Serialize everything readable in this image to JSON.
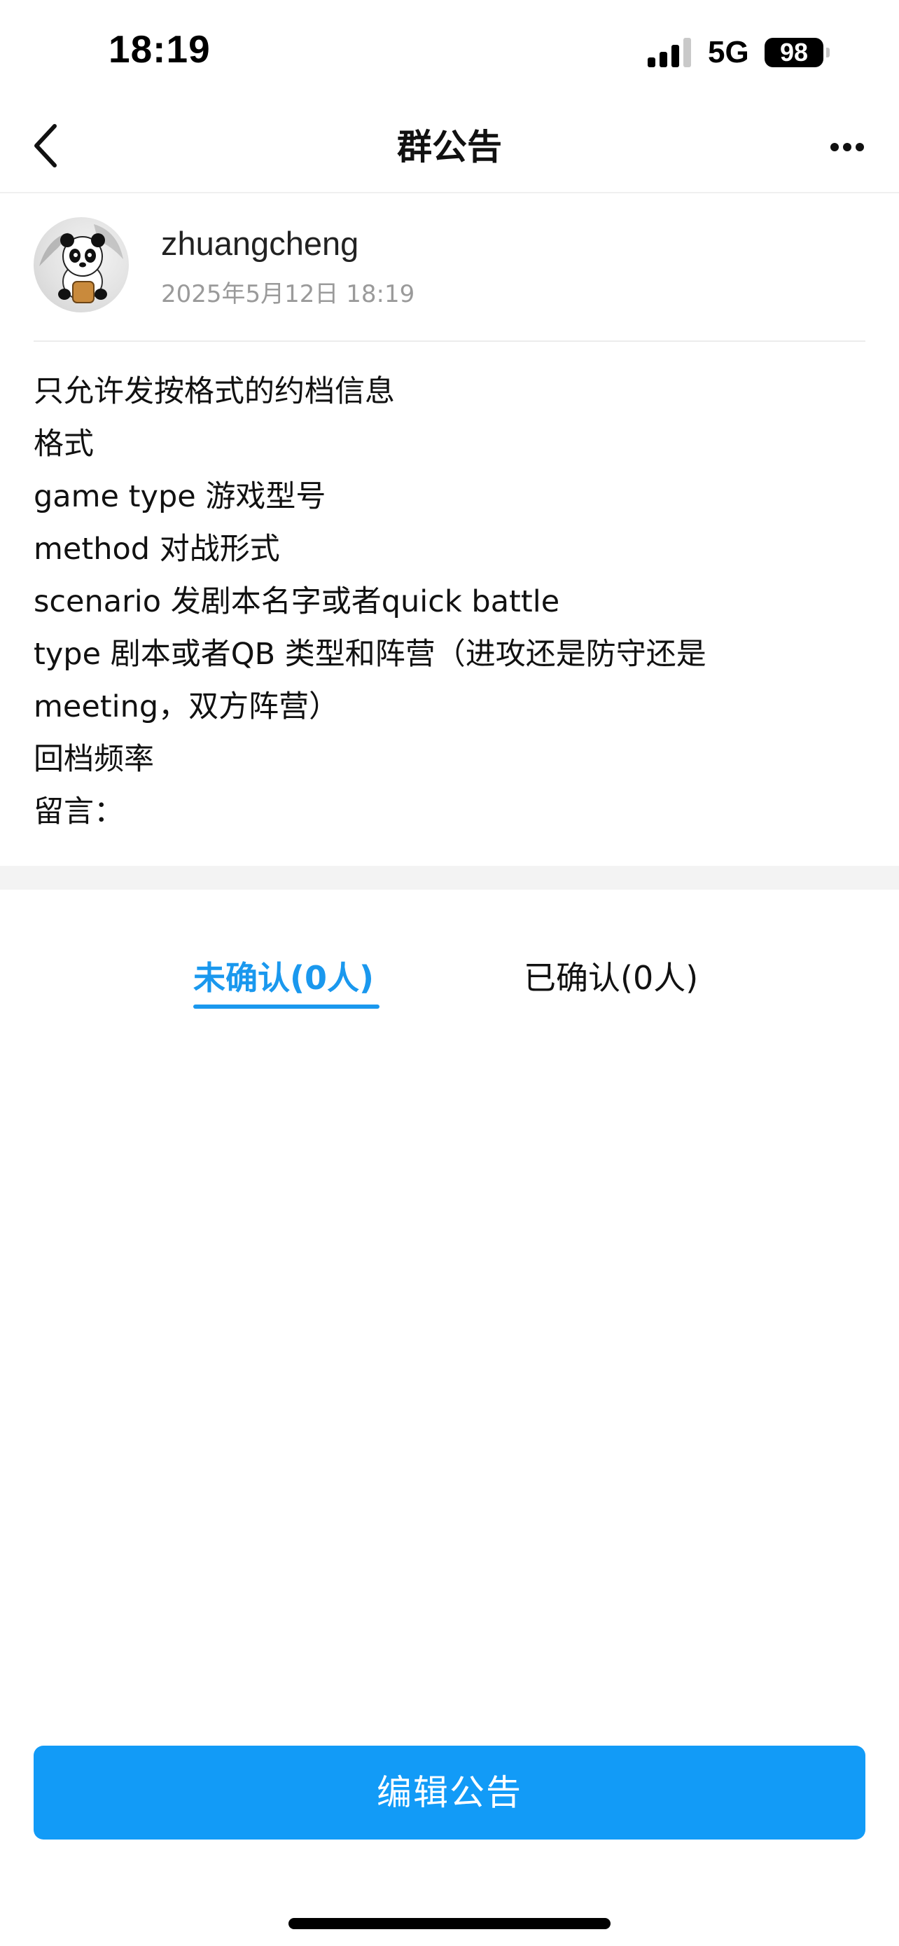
{
  "status_bar": {
    "time": "18:19",
    "network": "5G",
    "battery": "98"
  },
  "nav": {
    "title": "群公告",
    "back_icon": "chevron-left-icon",
    "more_icon": "more-horizontal-icon"
  },
  "author": {
    "name": "zhuangcheng",
    "timestamp": "2025年5月12日 18:19",
    "avatar_icon": "panda-avatar"
  },
  "announcement": {
    "lines": [
      "只允许发按格式的约档信息",
      "格式",
      "game type 游戏型号",
      "method 对战形式",
      "scenario 发剧本名字或者quick battle",
      "type 剧本或者QB 类型和阵营（进攻还是防守还是",
      "meeting，双方阵营）",
      "回档频率",
      "留言："
    ]
  },
  "tabs": {
    "unconfirmed": "未确认(0人)",
    "confirmed": "已确认(0人)",
    "active": "unconfirmed"
  },
  "actions": {
    "edit_label": "编辑公告"
  },
  "colors": {
    "accent": "#1a98ee",
    "button": "#129bf7",
    "muted_text": "#9a9a9a"
  }
}
